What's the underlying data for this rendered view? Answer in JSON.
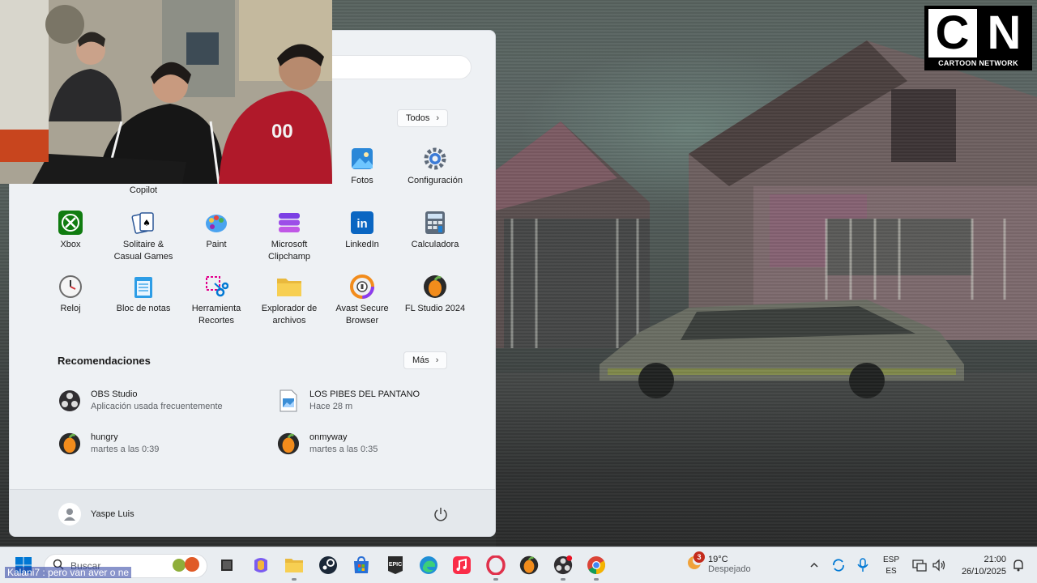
{
  "overlay": {
    "channel_logo": "CN",
    "channel_caption": "CARTOON NETWORK",
    "subtitle_text": "Kalani7 : pero van aver o ne"
  },
  "start_menu": {
    "pinned_header_button": "Todos",
    "pinned_apps": [
      {
        "label": "Copilot",
        "icon": "copilot-icon"
      },
      {
        "label": "Fotos",
        "icon": "photos-icon"
      },
      {
        "label": "Configuración",
        "icon": "settings-icon"
      },
      {
        "label": "Xbox",
        "icon": "xbox-icon"
      },
      {
        "label": "Solitaire &\nCasual Games",
        "icon": "solitaire-icon"
      },
      {
        "label": "Paint",
        "icon": "paint-icon"
      },
      {
        "label": "Microsoft\nClipchamp",
        "icon": "clipchamp-icon"
      },
      {
        "label": "LinkedIn",
        "icon": "linkedin-icon"
      },
      {
        "label": "Calculadora",
        "icon": "calculator-icon"
      },
      {
        "label": "Reloj",
        "icon": "clock-icon"
      },
      {
        "label": "Bloc de notas",
        "icon": "notepad-icon"
      },
      {
        "label": "Herramienta\nRecortes",
        "icon": "snipping-tool-icon"
      },
      {
        "label": "Explorador de\narchivos",
        "icon": "file-explorer-icon"
      },
      {
        "label": "Avast Secure\nBrowser",
        "icon": "avast-browser-icon"
      },
      {
        "label": "FL Studio 2024",
        "icon": "fl-studio-icon"
      }
    ],
    "recommendations_title": "Recomendaciones",
    "more_button": "Más",
    "recommendations": [
      {
        "name": "OBS Studio",
        "sub": "Aplicación usada frecuentemente",
        "icon": "obs-icon"
      },
      {
        "name": "LOS PIBES DEL PANTANO",
        "sub": "Hace 28 m",
        "icon": "image-file-icon"
      },
      {
        "name": "hungry",
        "sub": "martes a las 0:39",
        "icon": "fl-studio-icon"
      },
      {
        "name": "onmyway",
        "sub": "martes a las 0:35",
        "icon": "fl-studio-icon"
      }
    ],
    "user_name": "Yaspe Luis"
  },
  "taskbar": {
    "search_placeholder": "Buscar",
    "weather_badge": "3",
    "weather_temp": "19°C",
    "weather_condition": "Despejado",
    "language_top": "ESP",
    "language_bottom": "ES",
    "time": "21:00",
    "date": "26/10/2025"
  },
  "colors": {
    "start_menu_bg": "#eef1f4",
    "taskbar_bg": "#e9edf1",
    "accent_blue": "#0078d4",
    "fl_orange": "#f28c1c"
  }
}
